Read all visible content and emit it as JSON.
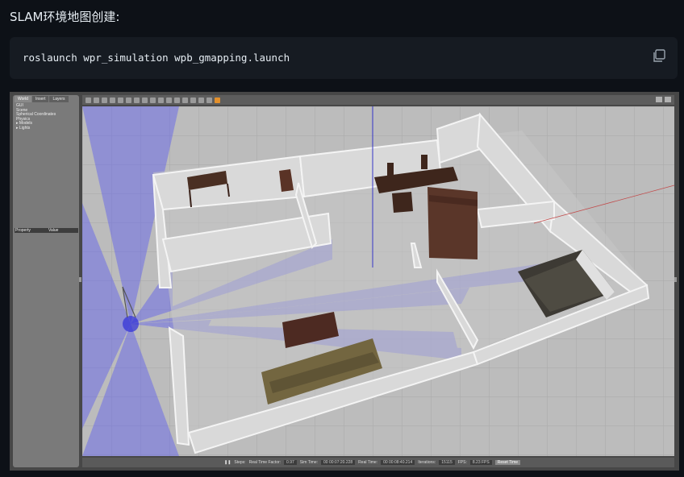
{
  "page": {
    "heading": "SLAM环境地图创建:"
  },
  "code_block": {
    "command": "roslaunch wpr_simulation wpb_gmapping.launch",
    "copy_icon": "copy-icon"
  },
  "gazebo": {
    "tabs": [
      "World",
      "Insert",
      "Layers"
    ],
    "tree": [
      "GUI",
      "Scene",
      "Spherical Coordinates",
      "Physics",
      "▸ Models",
      "▸ Lights"
    ],
    "property_table": {
      "col1": "Property",
      "col2": "Value"
    },
    "status": {
      "steps": "Steps:",
      "real_time_factor_label": "Real Time Factor:",
      "real_time_factor": "0.97",
      "sim_time_label": "Sim Time:",
      "sim_time": "00 00:07:20.228",
      "real_time_label": "Real Time:",
      "real_time": "00 00:08:40.214",
      "iterations_label": "Iterations:",
      "iterations": "15115",
      "fps_label": "FPS:",
      "fps": "8.23 FPS",
      "reset_time": "Reset Time"
    }
  }
}
